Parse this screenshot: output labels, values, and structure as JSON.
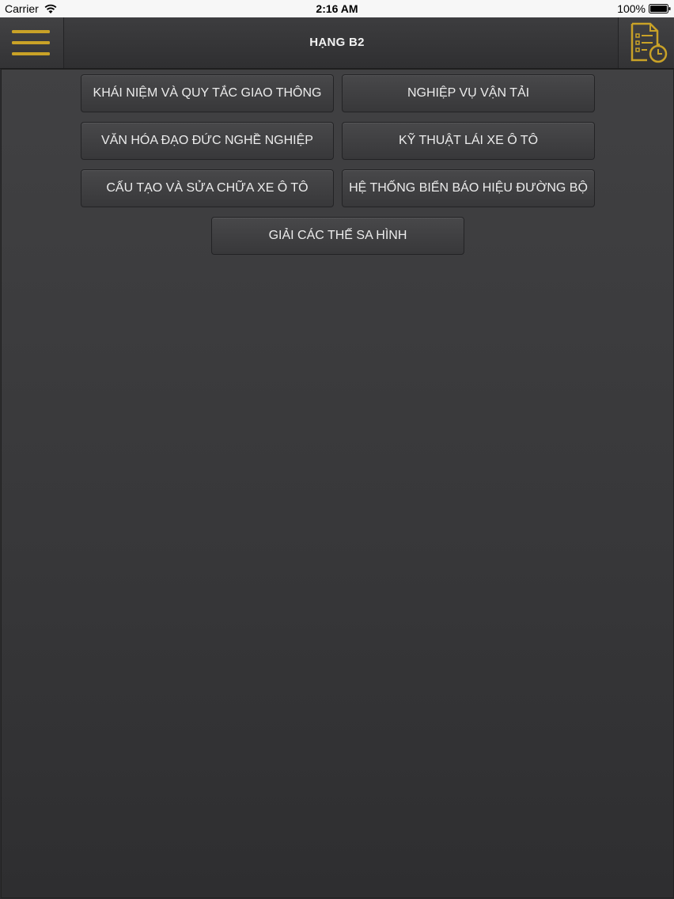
{
  "status_bar": {
    "carrier": "Carrier",
    "time": "2:16 AM",
    "battery": "100%"
  },
  "nav": {
    "title": "HẠNG B2",
    "menu_icon": "hamburger-menu-icon",
    "exam_icon": "exam-timer-icon",
    "accent_color": "#c9a227"
  },
  "topics": [
    {
      "label": "KHÁI NIỆM VÀ QUY TẮC GIAO THÔNG"
    },
    {
      "label": "NGHIỆP VỤ VẬN TẢI"
    },
    {
      "label": "VĂN HÓA ĐẠO ĐỨC NGHỀ NGHIỆP"
    },
    {
      "label": "KỸ THUẬT LÁI XE Ô TÔ"
    },
    {
      "label": "CẤU TẠO VÀ SỬA CHỮA XE Ô TÔ"
    },
    {
      "label": "HỆ THỐNG BIỂN BÁO HIỆU ĐƯỜNG BỘ"
    },
    {
      "label": "GIẢI CÁC THẾ SA HÌNH"
    }
  ]
}
